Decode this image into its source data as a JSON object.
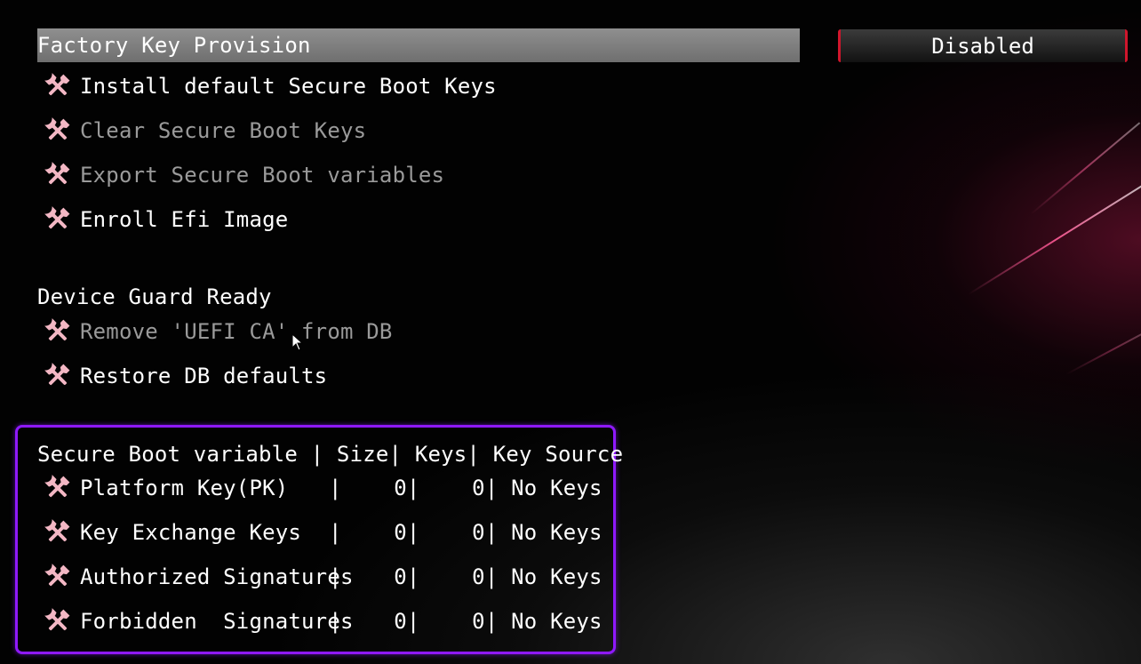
{
  "settings": {
    "factory_key_provision": {
      "label": "Factory Key Provision",
      "value": "Disabled"
    },
    "actions": [
      {
        "label": "Install default Secure Boot Keys",
        "enabled": true
      },
      {
        "label": "Clear Secure Boot Keys",
        "enabled": false
      },
      {
        "label": "Export Secure Boot variables",
        "enabled": false
      },
      {
        "label": "Enroll Efi Image",
        "enabled": true
      }
    ]
  },
  "device_guard": {
    "heading": "Device Guard Ready",
    "actions": [
      {
        "label": "Remove 'UEFI CA' from DB",
        "enabled": false
      },
      {
        "label": "Restore DB defaults",
        "enabled": true
      }
    ]
  },
  "variables_table": {
    "header": "Secure Boot variable | Size| Keys| Key Source",
    "rows": [
      {
        "name": "Platform Key(PK)    ",
        "size": "0",
        "keys": "0",
        "source": "No Keys"
      },
      {
        "name": "Key Exchange Keys   ",
        "size": "0",
        "keys": "0",
        "source": "No Keys"
      },
      {
        "name": "Authorized Signatures",
        "size": "0",
        "keys": "0",
        "source": "No Keys"
      },
      {
        "name": "Forbidden  Signatures",
        "size": "0",
        "keys": "0",
        "source": "No Keys"
      }
    ]
  },
  "icons": {
    "item": "tools-icon",
    "pointer": "mouse-cursor-icon"
  },
  "colors": {
    "accent": "#8f19ff",
    "selection": "#7f7f7f",
    "icon": "#f3b7c4",
    "value_edge": "#d0162c"
  }
}
